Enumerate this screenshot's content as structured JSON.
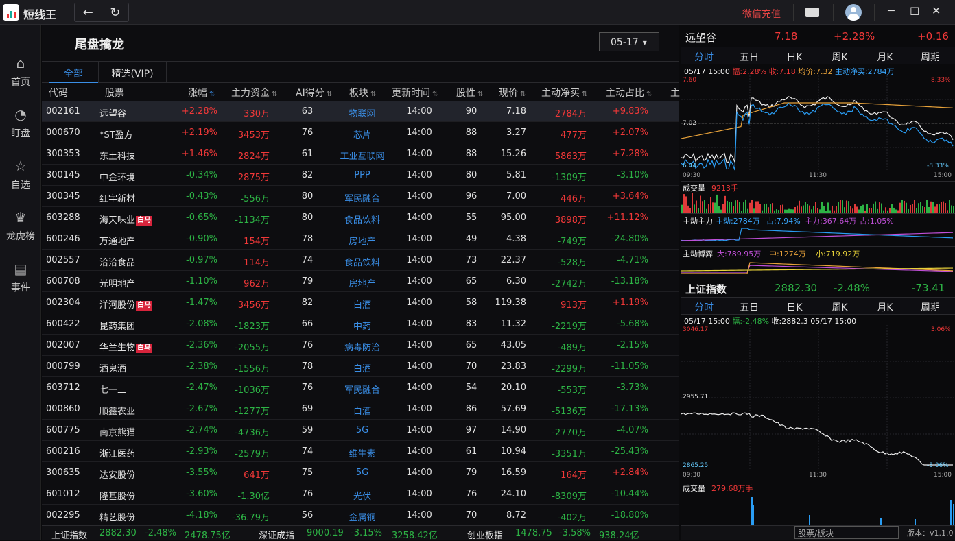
{
  "app": {
    "name": "短线王",
    "recharge": "微信充值"
  },
  "sidebar": [
    {
      "icon": "home-icon",
      "glyph": "⌂",
      "label": "首页"
    },
    {
      "icon": "monitor-icon",
      "glyph": "◔",
      "label": "盯盘"
    },
    {
      "icon": "star-icon",
      "glyph": "☆",
      "label": "自选"
    },
    {
      "icon": "trophy-icon",
      "glyph": "♛",
      "label": "龙虎榜"
    },
    {
      "icon": "document-icon",
      "glyph": "▤",
      "label": "事件"
    }
  ],
  "page": {
    "title": "尾盘擒龙",
    "date": "05-17"
  },
  "tabs": [
    "全部",
    "精选(VIP)"
  ],
  "columns": [
    "代码",
    "股票",
    "涨幅",
    "主力资金",
    "AI得分",
    "板块",
    "更新时间",
    "股性",
    "现价",
    "主动净买",
    "主动占比",
    "主"
  ],
  "rows": [
    {
      "code": "002161",
      "name": "远望谷",
      "badge": "",
      "chg": "+2.28%",
      "fund": "330万",
      "ai": "63",
      "sector": "物联网",
      "time": "14:00",
      "stk": "90",
      "price": "7.18",
      "net": "2784万",
      "pct": "+9.83%"
    },
    {
      "code": "000670",
      "name": "*ST盈方",
      "badge": "",
      "chg": "+2.19%",
      "fund": "3453万",
      "ai": "76",
      "sector": "芯片",
      "time": "14:00",
      "stk": "88",
      "price": "3.27",
      "net": "477万",
      "pct": "+2.07%"
    },
    {
      "code": "300353",
      "name": "东土科技",
      "badge": "",
      "chg": "+1.46%",
      "fund": "2824万",
      "ai": "61",
      "sector": "工业互联网",
      "time": "14:00",
      "stk": "88",
      "price": "15.26",
      "net": "5863万",
      "pct": "+7.28%"
    },
    {
      "code": "300145",
      "name": "中金环境",
      "badge": "",
      "chg": "-0.34%",
      "fund": "2875万",
      "ai": "82",
      "sector": "PPP",
      "time": "14:00",
      "stk": "80",
      "price": "5.81",
      "net": "-1309万",
      "pct": "-3.10%"
    },
    {
      "code": "300345",
      "name": "红宇新材",
      "badge": "",
      "chg": "-0.43%",
      "fund": "-556万",
      "ai": "80",
      "sector": "军民融合",
      "time": "14:00",
      "stk": "96",
      "price": "7.00",
      "net": "446万",
      "pct": "+3.64%"
    },
    {
      "code": "603288",
      "name": "海天味业",
      "badge": "白马",
      "chg": "-0.65%",
      "fund": "-1134万",
      "ai": "80",
      "sector": "食品饮料",
      "time": "14:00",
      "stk": "55",
      "price": "95.00",
      "net": "3898万",
      "pct": "+11.12%"
    },
    {
      "code": "600246",
      "name": "万通地产",
      "badge": "",
      "chg": "-0.90%",
      "fund": "154万",
      "ai": "78",
      "sector": "房地产",
      "time": "14:00",
      "stk": "49",
      "price": "4.38",
      "net": "-749万",
      "pct": "-24.80%"
    },
    {
      "code": "002557",
      "name": "洽洽食品",
      "badge": "",
      "chg": "-0.97%",
      "fund": "114万",
      "ai": "74",
      "sector": "食品饮料",
      "time": "14:00",
      "stk": "73",
      "price": "22.37",
      "net": "-528万",
      "pct": "-4.71%"
    },
    {
      "code": "600708",
      "name": "光明地产",
      "badge": "",
      "chg": "-1.10%",
      "fund": "962万",
      "ai": "79",
      "sector": "房地产",
      "time": "14:00",
      "stk": "65",
      "price": "6.30",
      "net": "-2742万",
      "pct": "-13.18%"
    },
    {
      "code": "002304",
      "name": "洋河股份",
      "badge": "白马",
      "chg": "-1.47%",
      "fund": "3456万",
      "ai": "82",
      "sector": "白酒",
      "time": "14:00",
      "stk": "58",
      "price": "119.38",
      "net": "913万",
      "pct": "+1.19%"
    },
    {
      "code": "600422",
      "name": "昆药集团",
      "badge": "",
      "chg": "-2.08%",
      "fund": "-1823万",
      "ai": "66",
      "sector": "中药",
      "time": "14:00",
      "stk": "83",
      "price": "11.32",
      "net": "-2219万",
      "pct": "-5.68%"
    },
    {
      "code": "002007",
      "name": "华兰生物",
      "badge": "白马",
      "chg": "-2.36%",
      "fund": "-2055万",
      "ai": "76",
      "sector": "病毒防治",
      "time": "14:00",
      "stk": "65",
      "price": "43.05",
      "net": "-489万",
      "pct": "-2.15%"
    },
    {
      "code": "000799",
      "name": "酒鬼酒",
      "badge": "",
      "chg": "-2.38%",
      "fund": "-1556万",
      "ai": "78",
      "sector": "白酒",
      "time": "14:00",
      "stk": "70",
      "price": "23.83",
      "net": "-2299万",
      "pct": "-11.05%"
    },
    {
      "code": "603712",
      "name": "七一二",
      "badge": "",
      "chg": "-2.47%",
      "fund": "-1036万",
      "ai": "76",
      "sector": "军民融合",
      "time": "14:00",
      "stk": "54",
      "price": "20.10",
      "net": "-553万",
      "pct": "-3.73%"
    },
    {
      "code": "000860",
      "name": "顺鑫农业",
      "badge": "",
      "chg": "-2.67%",
      "fund": "-1277万",
      "ai": "69",
      "sector": "白酒",
      "time": "14:00",
      "stk": "86",
      "price": "57.69",
      "net": "-5136万",
      "pct": "-17.13%"
    },
    {
      "code": "600775",
      "name": "南京熊猫",
      "badge": "",
      "chg": "-2.74%",
      "fund": "-4736万",
      "ai": "59",
      "sector": "5G",
      "time": "14:00",
      "stk": "97",
      "price": "14.90",
      "net": "-2770万",
      "pct": "-4.07%"
    },
    {
      "code": "600216",
      "name": "浙江医药",
      "badge": "",
      "chg": "-2.93%",
      "fund": "-2579万",
      "ai": "74",
      "sector": "维生素",
      "time": "14:00",
      "stk": "61",
      "price": "10.94",
      "net": "-3351万",
      "pct": "-25.43%"
    },
    {
      "code": "300635",
      "name": "达安股份",
      "badge": "",
      "chg": "-3.55%",
      "fund": "641万",
      "ai": "75",
      "sector": "5G",
      "time": "14:00",
      "stk": "79",
      "price": "16.59",
      "net": "164万",
      "pct": "+2.84%"
    },
    {
      "code": "601012",
      "name": "隆基股份",
      "badge": "",
      "chg": "-3.60%",
      "fund": "-1.30亿",
      "ai": "76",
      "sector": "光伏",
      "time": "14:00",
      "stk": "76",
      "price": "24.10",
      "net": "-8309万",
      "pct": "-10.44%"
    },
    {
      "code": "002295",
      "name": "精艺股份",
      "badge": "",
      "chg": "-4.18%",
      "fund": "-36.79万",
      "ai": "56",
      "sector": "金属铜",
      "time": "14:00",
      "stk": "70",
      "price": "8.72",
      "net": "-402万",
      "pct": "-18.80%"
    }
  ],
  "status": {
    "sh": {
      "name": "上证指数",
      "val": "2882.30",
      "chg": "-2.48%",
      "amt": "2478.75亿"
    },
    "sz": {
      "name": "深证成指",
      "val": "9000.19",
      "chg": "-3.15%",
      "amt": "3258.42亿"
    },
    "cy": {
      "name": "创业板指",
      "val": "1478.75",
      "chg": "-3.58%",
      "amt": "938.24亿"
    },
    "search_placeholder": "股票/板块",
    "version": "版本：v1.1.0"
  },
  "stock_panel": {
    "name": "远望谷",
    "price": "7.18",
    "chg": "+2.28%",
    "diff": "+0.16",
    "ktabs": [
      "分时",
      "五日",
      "日K",
      "周K",
      "月K",
      "周期"
    ],
    "info": {
      "date": "05/17 15:00",
      "fu": "幅:2.28%",
      "shou": "收:7.18",
      "avg": "均价:7.32",
      "buy": "主动净买:2784万"
    },
    "ymax": "7.60",
    "ymid": "7.02",
    "ymin": "6.44",
    "pmax": "8.33%",
    "pmin": "-8.33%",
    "times": [
      "09:30",
      "11:30",
      "15:00"
    ],
    "vol_label": "成交量",
    "vol_val": "9213手",
    "zl": {
      "label": "主动主力",
      "a": "主动:2784万",
      "b": "占:7.94%",
      "c": "主力:367.64万",
      "d": "占:1.05%"
    },
    "bo": {
      "label": "主动博弈",
      "a": "大:789.95万",
      "b": "中:1274万",
      "c": "小:719.92万"
    }
  },
  "index_panel": {
    "name": "上证指数",
    "price": "2882.30",
    "chg": "-2.48%",
    "diff": "-73.41",
    "info": {
      "date": "05/17 15:00",
      "fu": "幅:-2.48%",
      "shou": "收:2882.3",
      "date2": "05/17 15:00"
    },
    "ymax": "3046.17",
    "ymid": "2955.71",
    "ymin": "2865.25",
    "pmax": "3.06%",
    "pmin": "-3.06%",
    "vol_label": "成交量",
    "vol_val": "279.68万手"
  }
}
